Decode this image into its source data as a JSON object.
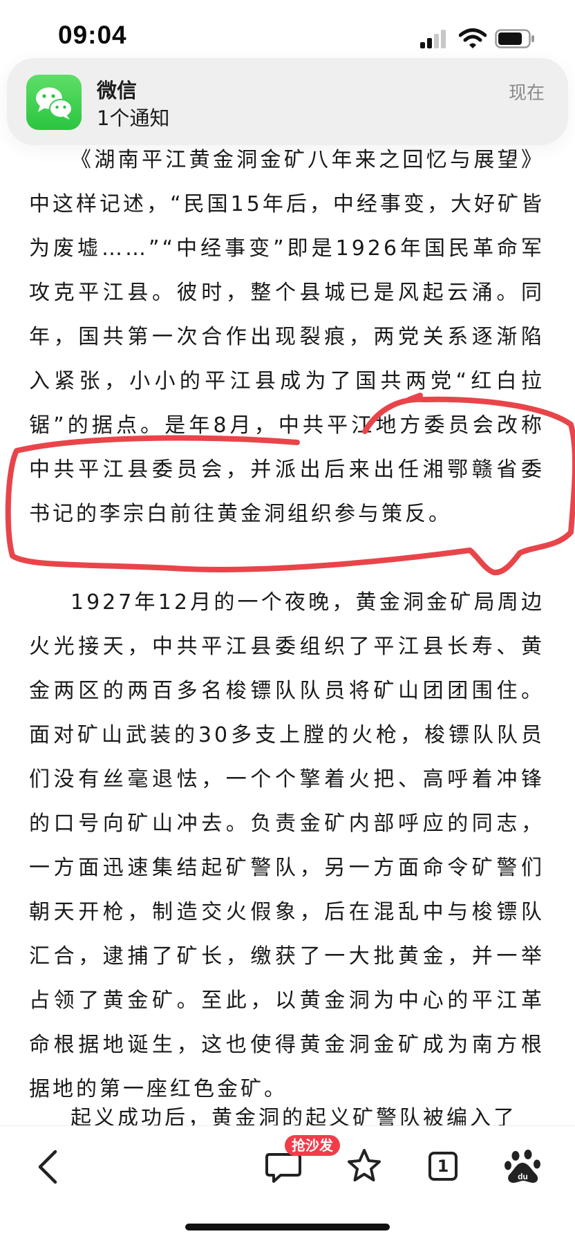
{
  "status_bar": {
    "time": "09:04"
  },
  "notification": {
    "app_name": "微信",
    "body": "1个通知",
    "time": "现在"
  },
  "article": {
    "paragraphs": [
      "《湖南平江黄金洞金矿八年来之回忆与展望》中这样记述，“民国15年后，中经事变，大好矿皆为废墟……”“中经事变”即是1926年国民革命军攻克平江县。彼时，整个县城已是风起云涌。同年，国共第一次合作出现裂痕，两党关系逐渐陷入紧张，小小的平江县成为了国共两党“红白拉锯”的据点。是年8月，中共平江地方委员会改称中共平江县委员会，并派出后来出任湘鄂赣省委书记的李宗白前往黄金洞组织参与策反。",
      "1927年12月的一个夜晚，黄金洞金矿局周边火光接天，中共平江县委组织了平江县长寿、黄金两区的两百多名梭镖队队员将矿山团团围住。面对矿山武装的30多支上膛的火枪，梭镖队队员们没有丝毫退怯，一个个擎着火把、高呼着冲锋的口号向矿山冲去。负责金矿内部呼应的同志，一方面迅速集结起矿警队，另一方面命令矿警们朝天开枪，制造交火假象，后在混乱中与梭镖队汇合，逮捕了矿长，缴获了一大批黄金，并一举占领了黄金矿。至此，以黄金洞为中心的平江革命根据地诞生，这也使得黄金洞金矿成为南方根据地的第一座红色金矿。",
      "起义成功后，黄金洞的起义矿警队被编入了"
    ]
  },
  "toolbar": {
    "comment_badge": "抢沙发",
    "tab_count": "1"
  },
  "colors": {
    "annotation": "#e8454a",
    "badge": "#f23c4a",
    "wechat": "#2ac540"
  }
}
